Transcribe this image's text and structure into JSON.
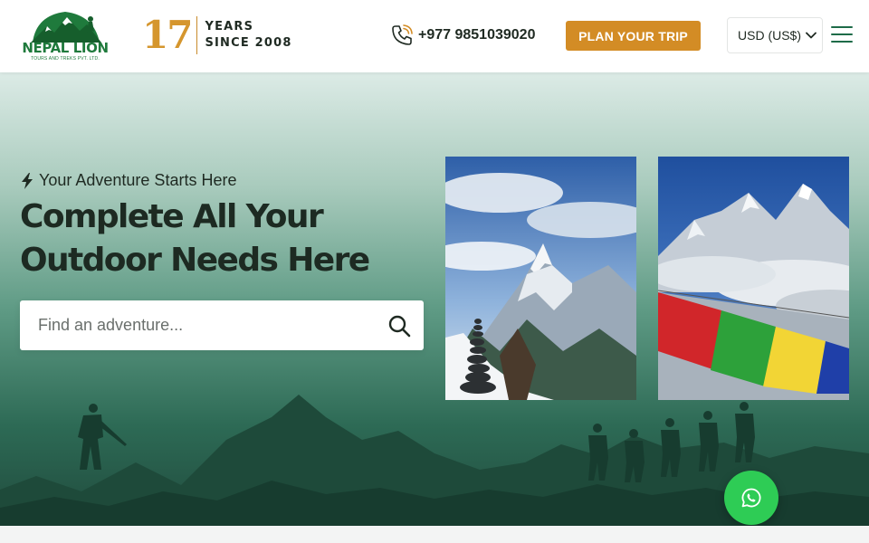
{
  "brand": {
    "name": "NEPAL LION",
    "tagline": "TOURS AND TREKS PVT. LTD.",
    "years_number": "17",
    "years_line1": "YEARS",
    "years_line2": "SINCE 2008"
  },
  "header": {
    "phone": "+977 9851039020",
    "cta_label": "PLAN YOUR TRIP",
    "currency_label": "USD (US$)"
  },
  "hero": {
    "tagline": "Your Adventure Starts Here",
    "headline_line1": "Complete All Your",
    "headline_line2": "Outdoor Needs Here",
    "search_placeholder": "Find an adventure..."
  },
  "icons": {
    "phone": "phone-icon",
    "bolt": "bolt-icon",
    "search": "search-icon",
    "menu": "hamburger-menu-icon",
    "chevron": "chevron-down-icon",
    "whatsapp": "whatsapp-icon"
  },
  "colors": {
    "brand_green": "#1f7a3c",
    "accent_gold": "#d38c25",
    "whatsapp_green": "#2ecc55",
    "hero_dark": "#204b3d"
  }
}
